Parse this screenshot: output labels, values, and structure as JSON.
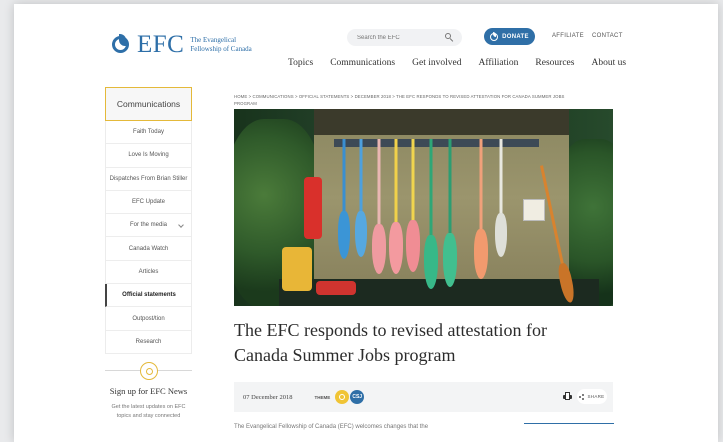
{
  "header": {
    "logo_text": "EFC",
    "logo_sub_line1": "The Evangelical",
    "logo_sub_line2": "Fellowship of Canada",
    "search_placeholder": "Search the EFC",
    "donate_label": "DONATE",
    "affiliate_label": "AFFILIATE",
    "contact_label": "CONTACT"
  },
  "nav": {
    "items": [
      {
        "label": "Topics"
      },
      {
        "label": "Communications"
      },
      {
        "label": "Get involved"
      },
      {
        "label": "Affiliation"
      },
      {
        "label": "Resources"
      },
      {
        "label": "About us"
      }
    ]
  },
  "sidebar": {
    "title": "Communications",
    "items": [
      {
        "label": "Faith Today"
      },
      {
        "label": "Love Is Moving"
      },
      {
        "label": "Dispatches From Brian Stiller"
      },
      {
        "label": "EFC Update"
      },
      {
        "label": "For the media"
      },
      {
        "label": "Canada Watch"
      },
      {
        "label": "Articles"
      },
      {
        "label": "Official statements"
      },
      {
        "label": "Outpost/tion"
      },
      {
        "label": "Research"
      }
    ],
    "active_index": 7
  },
  "signup": {
    "title": "Sign up for EFC News",
    "text_line1": "Get the latest updates on EFC",
    "text_line2": "topics and stay connected"
  },
  "breadcrumb": {
    "line1": "HOME > COMMUNICATIONS > OFFICIAL STATEMENTS > DECEMBER 2018 > THE EFC RESPONDS TO REVISED ATTESTATION FOR CANADA SUMMER JOBS",
    "line2": "PROGRAM"
  },
  "article": {
    "title_line1": "The EFC responds to revised attestation for",
    "title_line2": "Canada Summer Jobs program",
    "date": "07 December 2018",
    "themes_label": "THEME",
    "theme_badge": "CSJ",
    "share_label": "SHARE",
    "body_start": "The Evangelical Fellowship of Canada (EFC) welcomes changes that the"
  },
  "colors": {
    "brand_blue": "#2f6fa7",
    "accent_gold": "#e4b93a"
  }
}
